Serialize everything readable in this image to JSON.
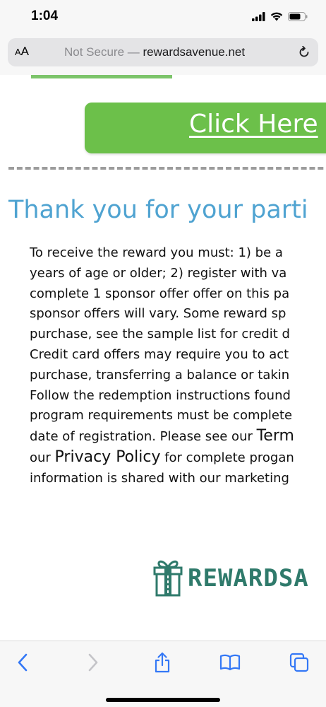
{
  "status_bar": {
    "time": "1:04",
    "icons": [
      "signal-icon",
      "wifi-icon",
      "battery-icon"
    ]
  },
  "address_bar": {
    "aa_label_small": "A",
    "aa_label_large": "A",
    "security_label": "Not Secure —",
    "domain": "rewardsavenue.net",
    "icons": [
      "reload-icon"
    ]
  },
  "page": {
    "cta_button_label": "Click Here",
    "heading": "Thank you for your parti",
    "terms": {
      "line1": "To receive the reward you must: 1) be a",
      "line2": "years of age or older; 2) register with va",
      "line3": "complete 1 sponsor offer offer on this pa",
      "line4": "sponsor offers will vary. Some reward sp",
      "line5": "purchase, see the sample list for credit d",
      "line6": "Credit card offers may require you to act",
      "line7": "purchase, transferring a balance or takin",
      "line8": "Follow the redemption instructions found",
      "line9": "program requirements must be complete",
      "line10_start": "date of registration. Please see our ",
      "terms_link": "Term",
      "line11_start": "our ",
      "privacy_link": "Privacy Policy",
      "line11_end": " for complete progan",
      "line12": "information is shared with our marketing"
    },
    "logo_text": "REWARDSA"
  },
  "toolbar": {
    "items": [
      "back-icon",
      "forward-icon",
      "share-icon",
      "bookmarks-icon",
      "tabs-icon"
    ]
  },
  "colors": {
    "cta_green": "#6cc04a",
    "heading_blue": "#4fa3d1",
    "logo_teal": "#2f7a6b",
    "toolbar_blue": "#3478f6"
  }
}
